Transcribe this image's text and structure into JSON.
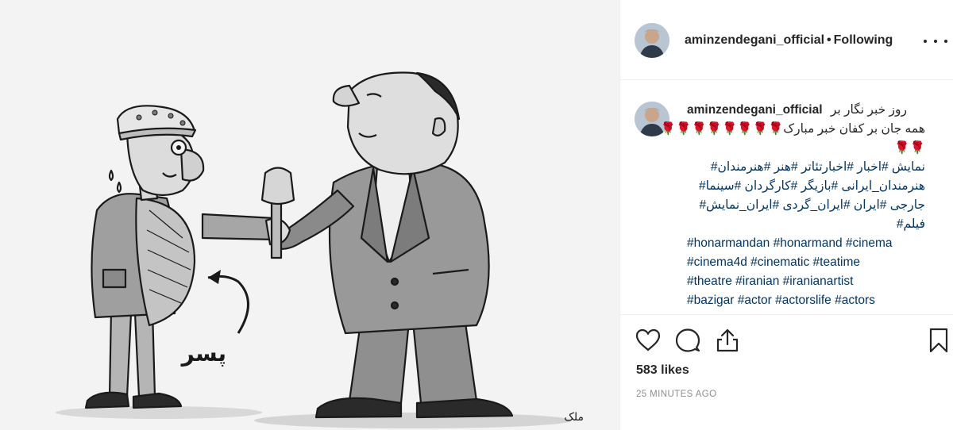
{
  "post": {
    "username": "aminzendegani_official",
    "separator": "•",
    "follow_status": "Following",
    "caption": {
      "username": "aminzendegani_official",
      "text_line1": "روز خبر نگار بر",
      "text_line2": "همه جان بر کفان خبر مبارک",
      "emoji_line2": "🌹🌹🌹🌹🌹🌹🌹🌹",
      "emoji_line3": "🌹🌹",
      "hashtags_fa": [
        "نمایش #اخبار #اخبارتئاتر #هنر #هنرمندان#",
        "هنرمندان_ایرانی #بازیگر #کارگردان #سینما#",
        "جارجی #ایران #ایران_گردی #ایران_نمایش#",
        "فیلم#"
      ],
      "hashtags_en": [
        "#honarmandan #honarmand #cinema",
        "#cinema4d #cinematic #teatime",
        "#theatre #iranian #iranianartist",
        "#bazigar #actor #actorslife #actors"
      ]
    },
    "likes": "583 likes",
    "time": "25 MINUTES AGO",
    "icons": {
      "like": "heart-icon",
      "comment": "comment-icon",
      "share": "share-icon",
      "save": "bookmark-icon",
      "more": "more-icon"
    },
    "image": {
      "cartoon_caption": "پسر",
      "signature": "ملک"
    }
  }
}
